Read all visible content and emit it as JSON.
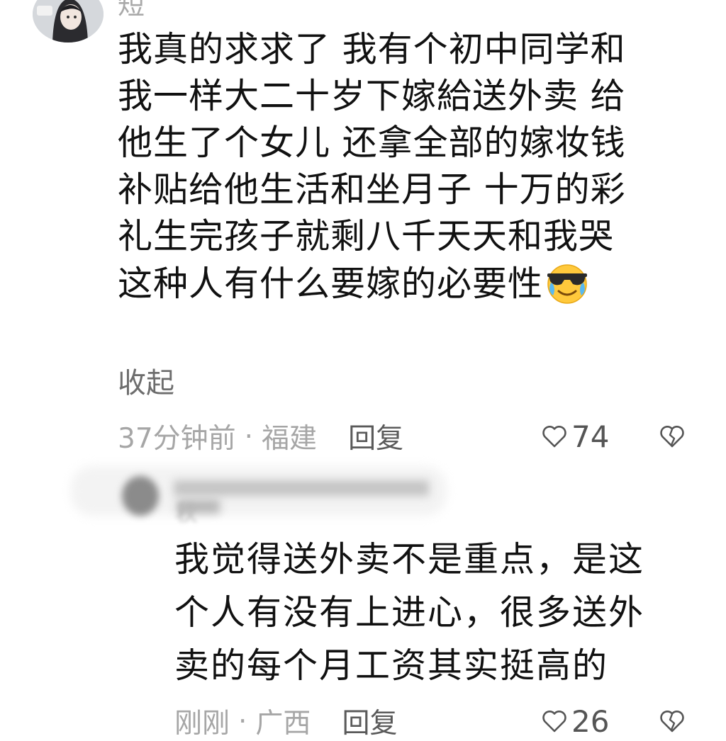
{
  "comment": {
    "username_partial": "短",
    "text_lines": [
      "我真的求求了 我有个初中同学和",
      "我一样大二十岁下嫁給送外卖 给",
      "他生了个女儿 还拿全部的嫁妆钱",
      "补贴给他生活和坐月子 十万的彩",
      "礼生完孩子就剩八千天天和我哭",
      "这种人有什么要嫁的必要性"
    ],
    "emoji": "crying-laughing-sunglasses-emoji",
    "collapse_label": "收起",
    "time": "37分钟前",
    "separator": "·",
    "location": "福建",
    "reply_label": "回复",
    "like_count": "74"
  },
  "reply": {
    "username_partial": "秋",
    "text_lines": [
      "我觉得送外卖不是重点，是这",
      "个人有没有上进心，很多送外",
      "卖的每个月工资其实挺高的"
    ],
    "time": "刚刚",
    "separator": "·",
    "location": "广西",
    "reply_label": "回复",
    "like_count": "26"
  },
  "icons": {
    "like": "heart-outline-icon",
    "dislike": "broken-heart-icon"
  },
  "colors": {
    "text": "#111111",
    "muted": "#a6a6a6",
    "action": "#5a5a5a"
  }
}
